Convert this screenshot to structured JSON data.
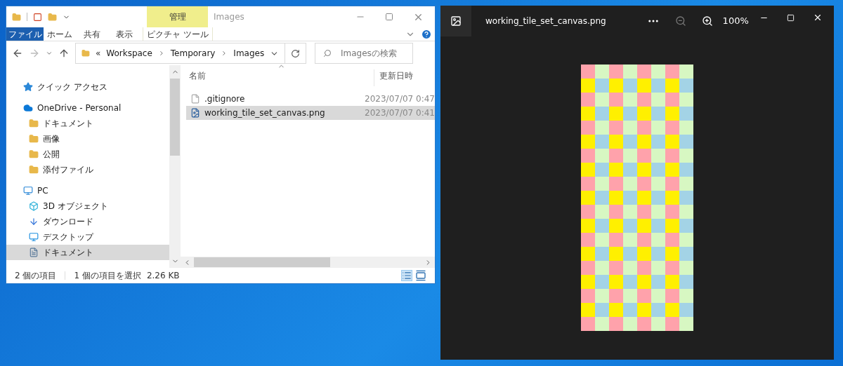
{
  "explorer": {
    "contextual_tab": "管理",
    "title": "Images",
    "ribbon_tabs": [
      {
        "label": "ファイル",
        "kind": "file"
      },
      {
        "label": "ホーム",
        "kind": "tab"
      },
      {
        "label": "共有",
        "kind": "tab"
      },
      {
        "label": "表示",
        "kind": "tab"
      },
      {
        "label": "ピクチャ ツール",
        "kind": "contextual"
      }
    ],
    "address": {
      "overflow": "«",
      "path": [
        "Workspace",
        "Temporary",
        "Images"
      ]
    },
    "search": {
      "placeholder": "Imagesの検索"
    },
    "sidebar": [
      {
        "label": "クイック アクセス",
        "kind": "star",
        "selected": false
      },
      {
        "label": "OneDrive - Personal",
        "kind": "cloud",
        "selected": false,
        "children": [
          {
            "label": "ドキュメント",
            "kind": "folder",
            "selected": false
          },
          {
            "label": "画像",
            "kind": "folder",
            "selected": false
          },
          {
            "label": "公開",
            "kind": "folder",
            "selected": false
          },
          {
            "label": "添付ファイル",
            "kind": "folder",
            "selected": false
          }
        ]
      },
      {
        "label": "PC",
        "kind": "pc",
        "selected": false,
        "children": [
          {
            "label": "3D オブジェクト",
            "kind": "cube",
            "selected": false
          },
          {
            "label": "ダウンロード",
            "kind": "download",
            "selected": false
          },
          {
            "label": "デスクトップ",
            "kind": "desktop",
            "selected": false
          },
          {
            "label": "ドキュメント",
            "kind": "document",
            "selected": true
          }
        ]
      }
    ],
    "columns": [
      "名前",
      "更新日時"
    ],
    "files": [
      {
        "name": ".gitignore",
        "date": "2023/07/07 0:47",
        "kind": "text",
        "selected": false
      },
      {
        "name": "working_tile_set_canvas.png",
        "date": "2023/07/07 0:41",
        "kind": "image",
        "selected": true
      }
    ],
    "status": {
      "count": "2 個の項目",
      "selection": "1 個の項目を選択",
      "size": "2.26 KB"
    }
  },
  "viewer": {
    "title": "working_tile_set_canvas.png",
    "zoom": "100%"
  }
}
